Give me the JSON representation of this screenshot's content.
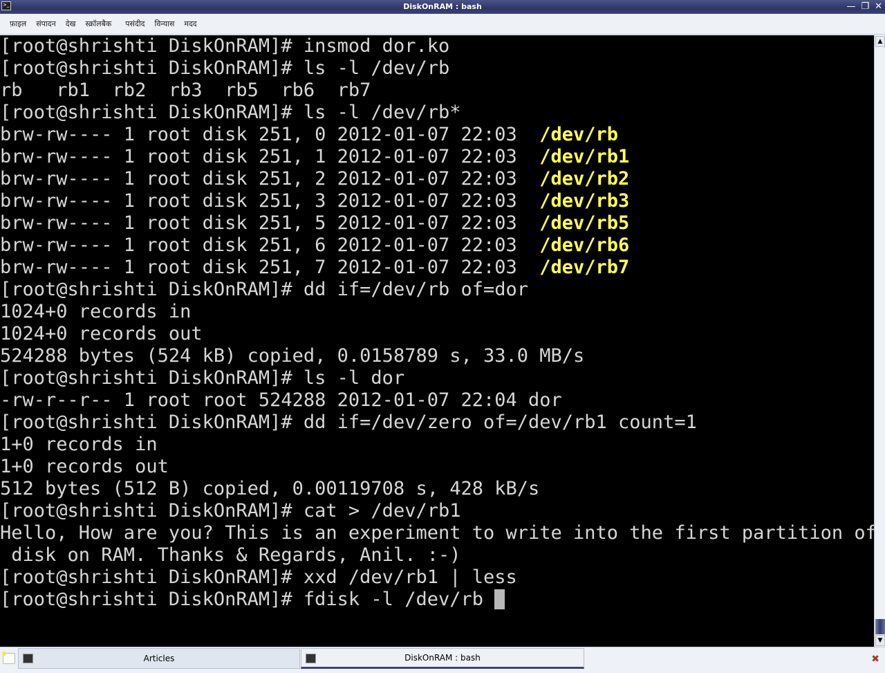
{
  "window": {
    "title": "DiskOnRAM : bash",
    "minimize": "—",
    "maximize": "❐",
    "close": "✕"
  },
  "menu": [
    "फ़ाइल",
    "संपादन",
    "देख",
    "स्क्रॉलबैक",
    "पसंदीद",
    "विन्यास",
    "मदद"
  ],
  "terminal": {
    "lines": [
      {
        "text": "[root@shrishti DiskOnRAM]# insmod dor.ko",
        "hl": ""
      },
      {
        "text": "[root@shrishti DiskOnRAM]# ls -l /dev/rb",
        "hl": ""
      },
      {
        "text": "rb   rb1  rb2  rb3  rb5  rb6  rb7",
        "hl": ""
      },
      {
        "text": "[root@shrishti DiskOnRAM]# ls -l /dev/rb*",
        "hl": ""
      },
      {
        "text": "brw-rw---- 1 root disk 251, 0 2012-01-07 22:03  ",
        "hl": "/dev/rb"
      },
      {
        "text": "brw-rw---- 1 root disk 251, 1 2012-01-07 22:03  ",
        "hl": "/dev/rb1"
      },
      {
        "text": "brw-rw---- 1 root disk 251, 2 2012-01-07 22:03  ",
        "hl": "/dev/rb2"
      },
      {
        "text": "brw-rw---- 1 root disk 251, 3 2012-01-07 22:03  ",
        "hl": "/dev/rb3"
      },
      {
        "text": "brw-rw---- 1 root disk 251, 5 2012-01-07 22:03  ",
        "hl": "/dev/rb5"
      },
      {
        "text": "brw-rw---- 1 root disk 251, 6 2012-01-07 22:03  ",
        "hl": "/dev/rb6"
      },
      {
        "text": "brw-rw---- 1 root disk 251, 7 2012-01-07 22:03  ",
        "hl": "/dev/rb7"
      },
      {
        "text": "[root@shrishti DiskOnRAM]# dd if=/dev/rb of=dor",
        "hl": ""
      },
      {
        "text": "1024+0 records in",
        "hl": ""
      },
      {
        "text": "1024+0 records out",
        "hl": ""
      },
      {
        "text": "524288 bytes (524 kB) copied, 0.0158789 s, 33.0 MB/s",
        "hl": ""
      },
      {
        "text": "[root@shrishti DiskOnRAM]# ls -l dor",
        "hl": ""
      },
      {
        "text": "-rw-r--r-- 1 root root 524288 2012-01-07 22:04 dor",
        "hl": ""
      },
      {
        "text": "[root@shrishti DiskOnRAM]# dd if=/dev/zero of=/dev/rb1 count=1",
        "hl": ""
      },
      {
        "text": "1+0 records in",
        "hl": ""
      },
      {
        "text": "1+0 records out",
        "hl": ""
      },
      {
        "text": "512 bytes (512 B) copied, 0.00119708 s, 428 kB/s",
        "hl": ""
      },
      {
        "text": "[root@shrishti DiskOnRAM]# cat > /dev/rb1",
        "hl": ""
      },
      {
        "text": "Hello, How are you? This is an experiment to write into the first partition of",
        "hl": ""
      },
      {
        "text": " disk on RAM. Thanks & Regards, Anil. :-)",
        "hl": ""
      },
      {
        "text": "[root@shrishti DiskOnRAM]# xxd /dev/rb1 | less",
        "hl": ""
      },
      {
        "text": "[root@shrishti DiskOnRAM]# fdisk -l /dev/rb ",
        "hl": ""
      }
    ]
  },
  "taskbar": {
    "tasks": [
      {
        "label": "Articles"
      },
      {
        "label": "DiskOnRAM : bash"
      }
    ]
  },
  "colors": {
    "highlight": "#ffff54",
    "background": "#000000"
  }
}
